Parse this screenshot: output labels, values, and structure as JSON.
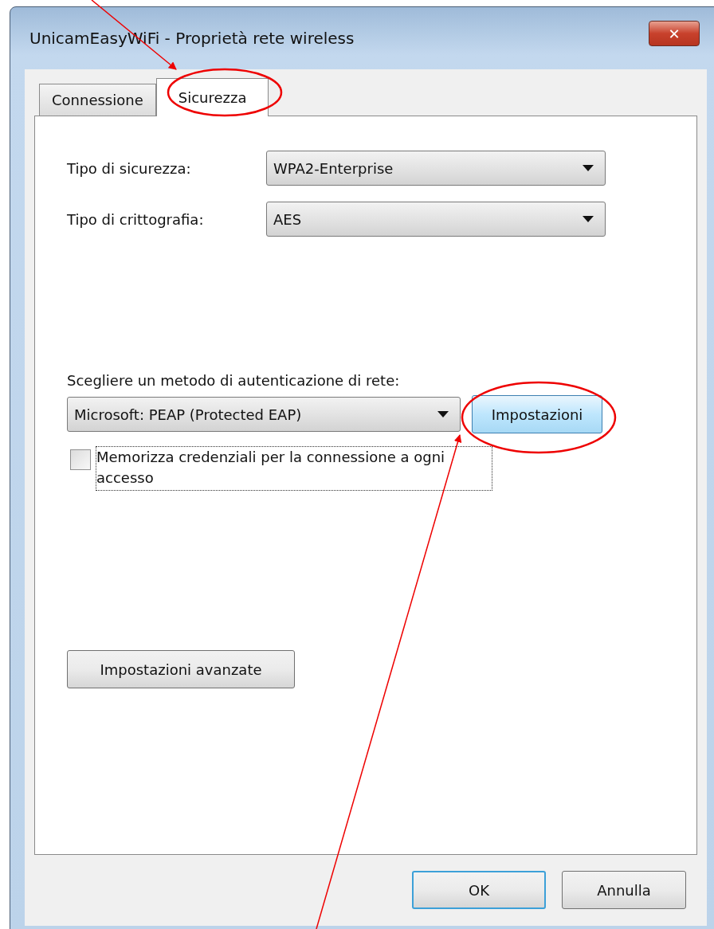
{
  "window": {
    "title": "UnicamEasyWiFi - Proprietà rete wireless",
    "close": "✕"
  },
  "tabs": [
    {
      "label": "Connessione",
      "selected": false
    },
    {
      "label": "Sicurezza",
      "selected": true
    }
  ],
  "fields": [
    {
      "label": "Tipo di sicurezza:",
      "value": "WPA2-Enterprise"
    },
    {
      "label": "Tipo di crittografia:",
      "value": "AES"
    }
  ],
  "auth": {
    "label": "Scegliere un metodo di autenticazione di rete:",
    "value": "Microsoft: PEAP (Protected EAP)",
    "button": {
      "label": "Impostazioni",
      "hovered": true
    }
  },
  "remember": {
    "label": "Memorizza credenziali per la connessione a ogni accesso",
    "checked": false
  },
  "advanced": {
    "label": "Impostazioni avanzate"
  },
  "buttons": [
    {
      "label": "OK",
      "default": true
    },
    {
      "label": "Annulla",
      "default": false
    }
  ]
}
